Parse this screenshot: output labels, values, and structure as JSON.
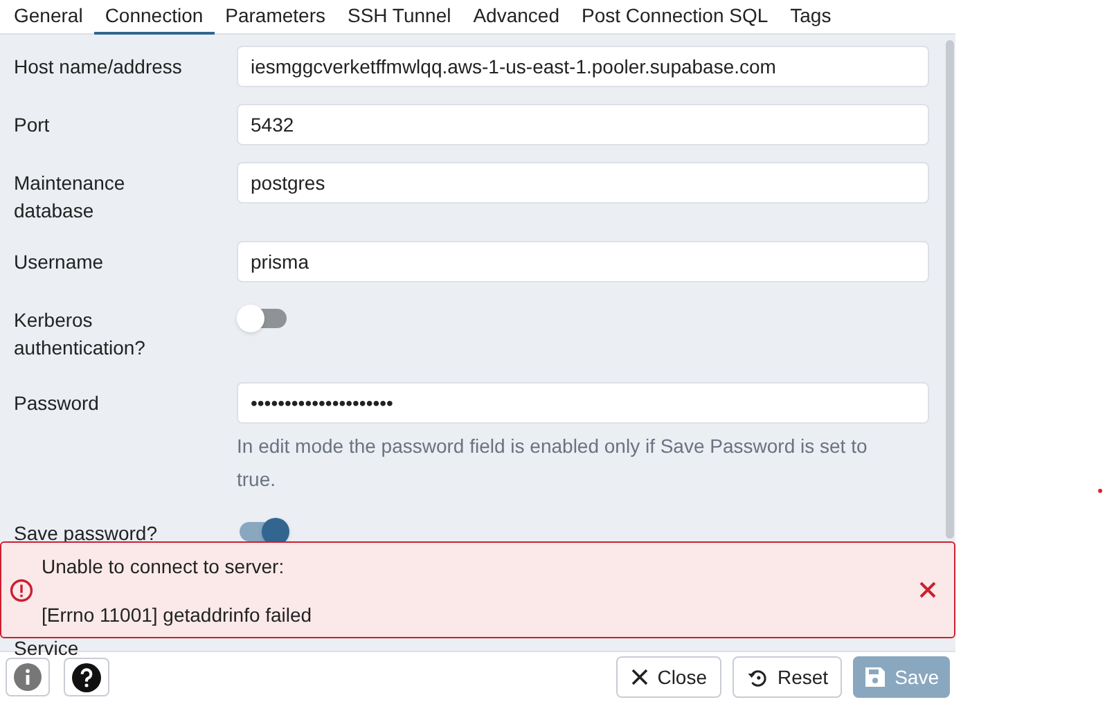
{
  "tabs": [
    {
      "label": "General",
      "selected": false
    },
    {
      "label": "Connection",
      "selected": true
    },
    {
      "label": "Parameters",
      "selected": false
    },
    {
      "label": "SSH Tunnel",
      "selected": false
    },
    {
      "label": "Advanced",
      "selected": false
    },
    {
      "label": "Post Connection SQL",
      "selected": false
    },
    {
      "label": "Tags",
      "selected": false
    }
  ],
  "fields": [
    {
      "kind": "text",
      "label": "Host name/address",
      "value": "iesmggcverketffmwlqq.aws-1-us-east-1.pooler.supabase.com"
    },
    {
      "kind": "text",
      "label": "Port",
      "value": "5432"
    },
    {
      "kind": "text",
      "label": "Maintenance database",
      "value": "postgres"
    },
    {
      "kind": "text",
      "label": "Username",
      "value": "prisma"
    },
    {
      "kind": "toggle",
      "label": "Kerberos authentication?",
      "on": false
    },
    {
      "kind": "password",
      "label": "Password",
      "value": "•••••••••••••••••••••",
      "help": "In edit mode the password field is enabled only if Save Password is set to true."
    },
    {
      "kind": "toggle",
      "label": "Save password?",
      "on": true
    },
    {
      "kind": "label",
      "label": "Service"
    }
  ],
  "error": {
    "title": "Unable to connect to server:",
    "detail": "[Errno 11001] getaddrinfo failed"
  },
  "buttons": [
    {
      "kind": "close",
      "label": "Close",
      "disabled": false
    },
    {
      "kind": "reset",
      "label": "Reset",
      "disabled": false
    },
    {
      "kind": "save",
      "label": "Save",
      "disabled": true
    }
  ]
}
